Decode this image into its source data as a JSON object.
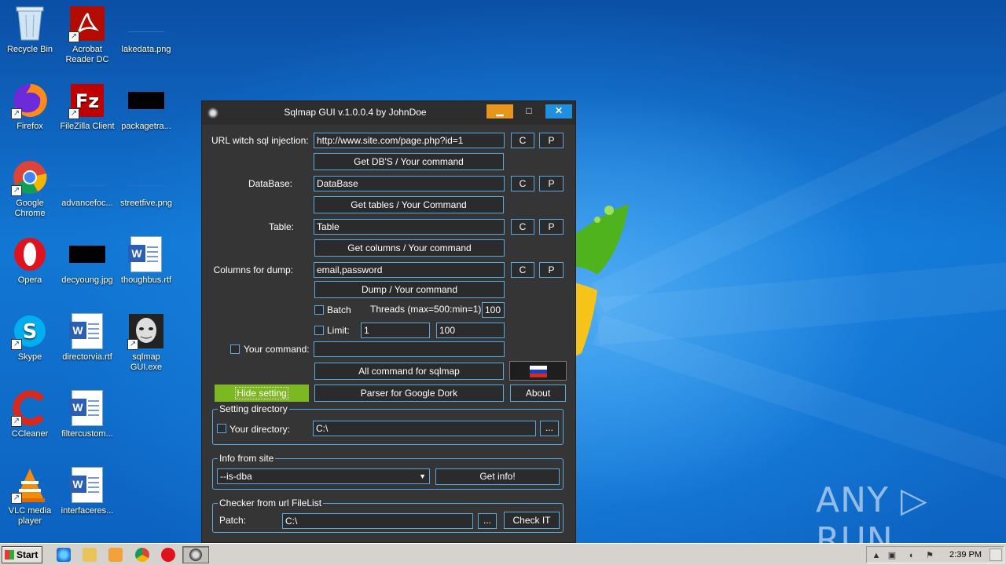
{
  "desktop_icons": [
    {
      "label": "Recycle Bin",
      "icon": "recycle-bin-icon"
    },
    {
      "label": "Acrobat Reader DC",
      "icon": "acrobat-icon"
    },
    {
      "label": "lakedata.png",
      "icon": "image-file-icon"
    },
    {
      "label": "Firefox",
      "icon": "firefox-icon"
    },
    {
      "label": "FileZilla Client",
      "icon": "filezilla-icon"
    },
    {
      "label": "packagetra...",
      "icon": "image-file-icon"
    },
    {
      "label": "Google Chrome",
      "icon": "chrome-icon"
    },
    {
      "label": "advancefoc...",
      "icon": "image-file-icon"
    },
    {
      "label": "streetfive.png",
      "icon": "image-file-icon"
    },
    {
      "label": "Opera",
      "icon": "opera-icon"
    },
    {
      "label": "decyoung.jpg",
      "icon": "image-file-icon"
    },
    {
      "label": "thoughbus.rtf",
      "icon": "word-doc-icon"
    },
    {
      "label": "Skype",
      "icon": "skype-icon"
    },
    {
      "label": "directorvia.rtf",
      "icon": "word-doc-icon"
    },
    {
      "label": "sqlmap GUI.exe",
      "icon": "sqlmap-exe-icon"
    },
    {
      "label": "CCleaner",
      "icon": "ccleaner-icon"
    },
    {
      "label": "filtercustom...",
      "icon": "word-doc-icon"
    },
    {
      "label": "VLC media player",
      "icon": "vlc-icon"
    },
    {
      "label": "interfaceres...",
      "icon": "word-doc-icon"
    }
  ],
  "window": {
    "title": "Sqlmap GUI v.1.0.0.4 by JohnDoe",
    "min_glyph": "▁",
    "max_glyph": "□",
    "close_glyph": "✕"
  },
  "form": {
    "url_label": "URL witch sql injection:",
    "url_value": "http://www.site.com/page.php?id=1",
    "get_dbs_button": "Get DB'S / Your command",
    "database_label": "DataBase:",
    "database_value": "DataBase",
    "get_tables_button": "Get tables / Your Command",
    "table_label": "Table:",
    "table_value": "Table",
    "get_columns_button": "Get columns / Your command",
    "columns_label": "Columns for dump:",
    "columns_value": "email,password",
    "dump_button": "Dump / Your command",
    "batch_label": "Batch",
    "threads_label": "Threads (max=500:min=1)  :",
    "threads_value": "100",
    "limit_label": "Limit:",
    "limit_from": "1",
    "limit_to": "100",
    "your_command_label": "Your command:",
    "your_command_value": "",
    "all_command_button": "All command for sqlmap",
    "c_button": "C",
    "p_button": "P",
    "hide_setting_button": "Hide setting",
    "parser_button": "Parser for Google Dork",
    "about_button": "About"
  },
  "setting_directory": {
    "title": "Setting directory",
    "your_directory_label": "Your directory:",
    "directory_value": "C:\\",
    "browse_button": "..."
  },
  "info_from_site": {
    "title": "Info from site",
    "selected_option": "--is-dba",
    "get_info_button": "Get info!"
  },
  "checker": {
    "title": "Checker from url FileList",
    "patch_label": "Patch:",
    "patch_value": "C:\\",
    "browse_button": "...",
    "check_button": "Check IT"
  },
  "taskbar": {
    "start_label": "Start",
    "clock": "2:39 PM"
  },
  "watermark": "ANY ▷ RUN",
  "colors": {
    "window_bg": "#353535",
    "input_border": "#5aa8e0",
    "hide_setting_bg": "#7cb821",
    "minimize_bg": "#e8961a",
    "close_bg": "#1f8fe0"
  }
}
